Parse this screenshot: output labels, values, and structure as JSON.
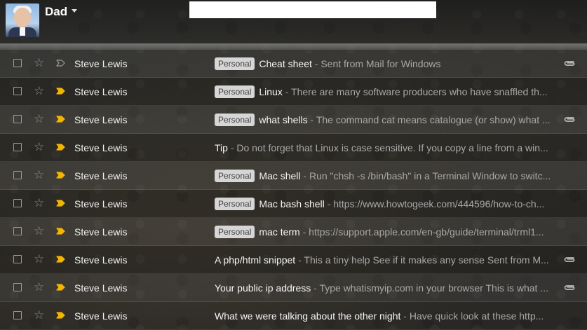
{
  "account": {
    "name": "Dad"
  },
  "search": {
    "placeholder": ""
  },
  "emails": [
    {
      "sender": "Steve Lewis",
      "label": "Personal",
      "subject": "Cheat sheet",
      "snippet": "Sent from Mail for Windows",
      "important": false,
      "attachment": true
    },
    {
      "sender": "Steve Lewis",
      "label": "Personal",
      "subject": "Linux",
      "snippet": "There are many software producers who have snaffled th...",
      "important": true,
      "attachment": false
    },
    {
      "sender": "Steve Lewis",
      "label": "Personal",
      "subject": "what shells",
      "snippet": "The command cat means catalogue (or show) what ...",
      "important": true,
      "attachment": true
    },
    {
      "sender": "Steve Lewis",
      "label": "",
      "subject": "Tip",
      "snippet": "Do not forget that Linux is case sensitive. If you copy a line from a win...",
      "important": true,
      "attachment": false
    },
    {
      "sender": "Steve Lewis",
      "label": "Personal",
      "subject": "Mac shell",
      "snippet": "Run \"chsh -s /bin/bash\" in a Terminal Window to switc...",
      "important": true,
      "attachment": false
    },
    {
      "sender": "Steve Lewis",
      "label": "Personal",
      "subject": "Mac bash shell",
      "snippet": "https://www.howtogeek.com/444596/how-to-ch...",
      "important": true,
      "attachment": false
    },
    {
      "sender": "Steve Lewis",
      "label": "Personal",
      "subject": "mac term",
      "snippet": "https://support.apple.com/en-gb/guide/terminal/trml1...",
      "important": true,
      "attachment": false
    },
    {
      "sender": "Steve Lewis",
      "label": "",
      "subject": "A php/html snippet",
      "snippet": "This a tiny help See if it makes any sense Sent from M...",
      "important": true,
      "attachment": true
    },
    {
      "sender": "Steve Lewis",
      "label": "",
      "subject": "Your public ip address",
      "snippet": "Type whatismyip.com in your browser This is what ...",
      "important": true,
      "attachment": true
    },
    {
      "sender": "Steve Lewis",
      "label": "",
      "subject": "What we were talking about the other night",
      "snippet": "Have quick look at these http...",
      "important": true,
      "attachment": false
    }
  ],
  "colors": {
    "important_marker": "#f4b400",
    "label_bg": "#d6d6d6"
  },
  "icons": {
    "checkbox": "checkbox-icon",
    "star": "star-icon",
    "important": "important-marker-icon",
    "attachment": "paperclip-icon"
  }
}
